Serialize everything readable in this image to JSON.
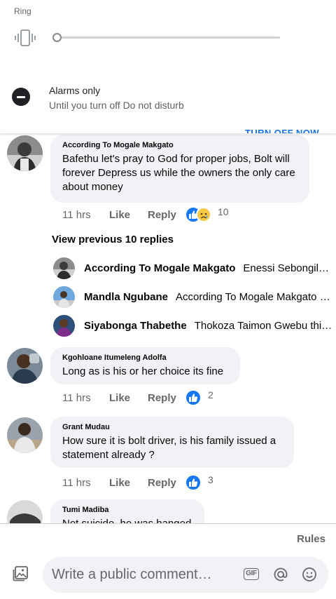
{
  "system": {
    "ring_label": "Ring",
    "ring_level": 0,
    "dnd_title": "Alarms only",
    "dnd_subtitle": "Until you turn off Do not disturb",
    "turn_off_label": "TURN OFF NOW"
  },
  "comments": [
    {
      "author": "According To Mogale Makgato",
      "text": "Bafethu let's pray to God for proper jobs, Bolt will forever Depress us while the owners the only care about money",
      "time": "11 hrs",
      "like_label": "Like",
      "reply_label": "Reply",
      "reactions": [
        "like",
        "sad"
      ],
      "reaction_count": "10"
    },
    {
      "author": "Kgohloane Itumeleng Adolfa",
      "text": "Long as is his or her choice its fine",
      "time": "11 hrs",
      "like_label": "Like",
      "reply_label": "Reply",
      "reactions": [
        "like"
      ],
      "reaction_count": "2"
    },
    {
      "author": "Grant Mudau",
      "text": "How sure it is bolt driver, is his family issued a statement already ?",
      "time": "11 hrs",
      "like_label": "Like",
      "reply_label": "Reply",
      "reactions": [
        "like"
      ],
      "reaction_count": "3"
    },
    {
      "author": "Tumi Madiba",
      "text": "Not suicide, he was hanged"
    }
  ],
  "replies": {
    "view_previous": "View previous 10 replies",
    "items": [
      {
        "name": "According To Mogale Makgato",
        "preview": "Enessi Sebongile Majozi and his family"
      },
      {
        "name": "Mandla Ngubane",
        "preview": "According To Mogale Makgato how do you know"
      },
      {
        "name": "Siyabonga Thabethe",
        "preview": "Thokoza Taimon Gwebu this is so sad"
      }
    ]
  },
  "footer": {
    "rules_label": "Rules",
    "composer_placeholder": "Write a public comment…",
    "gif_label": "GIF"
  },
  "colors": {
    "accent": "#1877f2",
    "bubble": "#f0f2f5",
    "secondary_text": "#65676b",
    "dnd_blue": "#1a73e8"
  }
}
